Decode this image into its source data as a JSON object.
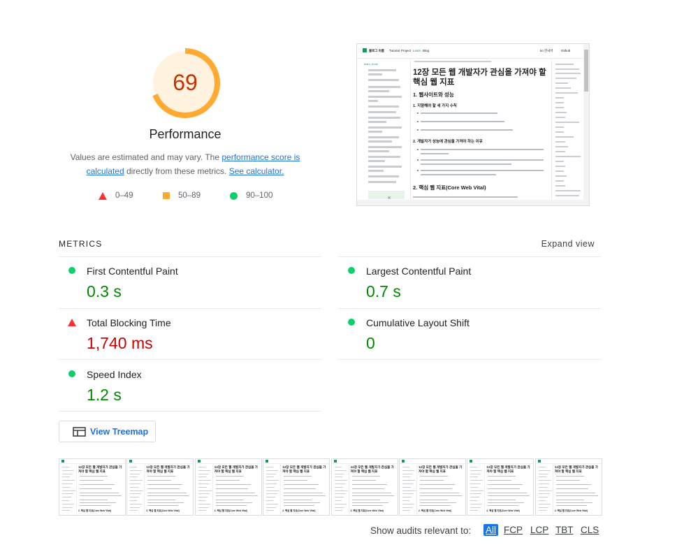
{
  "gauge": {
    "score": "69",
    "score_fraction": 0.69,
    "title": "Performance",
    "score_color": "#c33300",
    "arc_color": "#ffaa33",
    "bg_color": "#fff3e0"
  },
  "description": {
    "part1": "Values are estimated and may vary. The ",
    "link1": "performance score is calculated",
    "part2": " directly from these metrics. ",
    "link2": "See calculator."
  },
  "legend": [
    {
      "range": "0–49",
      "shape": "triangle-icon",
      "color": "#ff3333"
    },
    {
      "range": "50–89",
      "shape": "square-icon",
      "color": "#ffaa33"
    },
    {
      "range": "90–100",
      "shape": "circle-icon",
      "color": "#0cce6b"
    }
  ],
  "page_screenshot": {
    "nav_brand": "블로그 이름",
    "nav_links": [
      "Tutorial",
      "Project",
      "Learn",
      "Blog"
    ],
    "nav_right": [
      "ko 한국어",
      "Github"
    ],
    "sidebar_title": "learn_book",
    "collapse_icon": "«",
    "heading": "12장 모든 웹 개발자가 관심을 가져야 할 핵심 웹 지표",
    "section1": "1. 웹사이트와 성능",
    "subsection1": "1. 지향해야 할 세 가지 수칙",
    "subsection2": "2. 개발자가 성능에 관심을 가져야 하는 이유",
    "section2": "2. 핵심 웹 지표(Core Web Vital)"
  },
  "metrics": {
    "title": "METRICS",
    "expand_label": "Expand view",
    "items": [
      {
        "name": "First Contentful Paint",
        "value": "0.3 s",
        "status": "good"
      },
      {
        "name": "Largest Contentful Paint",
        "value": "0.7 s",
        "status": "good"
      },
      {
        "name": "Total Blocking Time",
        "value": "1,740 ms",
        "status": "poor"
      },
      {
        "name": "Cumulative Layout Shift",
        "value": "0",
        "status": "good"
      },
      {
        "name": "Speed Index",
        "value": "1.2 s",
        "status": "good"
      }
    ]
  },
  "treemap": {
    "label": "View Treemap"
  },
  "filmstrip": {
    "frame_count": 8,
    "frame_title": "12장 모든 웹 개발자가 관심을 가져야 할 핵심 웹 지표",
    "frame_section": "2. 핵심 웹 지표(Core Web Vital)"
  },
  "audits": {
    "label": "Show audits relevant to:",
    "filters": [
      "All",
      "FCP",
      "LCP",
      "TBT",
      "CLS"
    ],
    "active": "All"
  }
}
